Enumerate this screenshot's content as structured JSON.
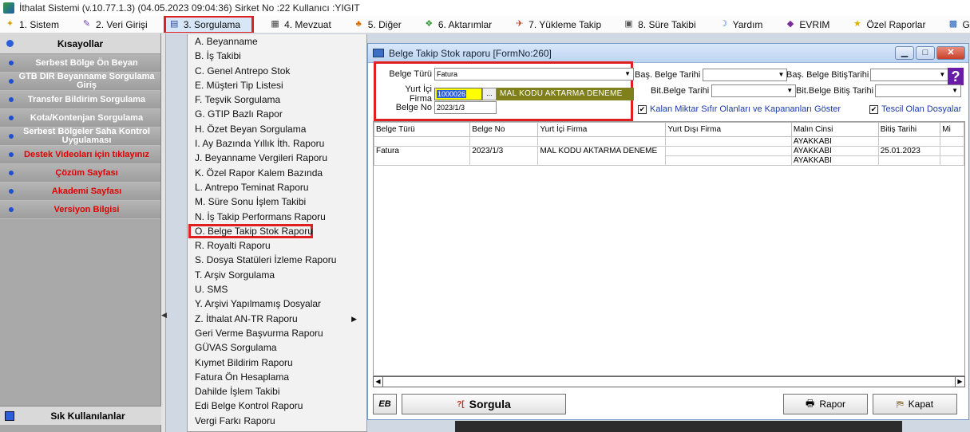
{
  "window": {
    "title": "İthalat Sistemi (v.10.77.1.3) (04.05.2023 09:04:36) Sirket No :22 Kullanıcı :YIGIT"
  },
  "menubar": [
    {
      "label": "1.  Sistem",
      "icon": "✦",
      "color": "#d4a017"
    },
    {
      "label": "2. Veri Girişi",
      "icon": "✎",
      "color": "#6a3fb0"
    },
    {
      "label": "3. Sorgulama",
      "icon": "▤",
      "color": "#2c4f9e"
    },
    {
      "label": "4. Mevzuat",
      "icon": "▦",
      "color": "#444"
    },
    {
      "label": "5. Diğer",
      "icon": "♣",
      "color": "#d86b00"
    },
    {
      "label": "6. Aktarımlar",
      "icon": "❖",
      "color": "#3a9b3a"
    },
    {
      "label": "7. Yükleme Takip",
      "icon": "✈",
      "color": "#c04020"
    },
    {
      "label": "8. Süre Takibi",
      "icon": "▣",
      "color": "#555"
    },
    {
      "label": "Yardım",
      "icon": "☽",
      "color": "#2a6fd8"
    },
    {
      "label": "EVRIM",
      "icon": "◆",
      "color": "#7a2a9e"
    },
    {
      "label": "Özel Raporlar",
      "icon": "★",
      "color": "#e0b000"
    },
    {
      "label": "Grafi",
      "icon": "▩",
      "color": "#1a5fb4"
    }
  ],
  "sidebar": {
    "header": "Kısayollar",
    "items": [
      {
        "label": "Serbest Bölge Ön Beyan",
        "red": false
      },
      {
        "label": "GTB DIR Beyanname Sorgulama Giriş",
        "red": false
      },
      {
        "label": "Transfer Bildirim Sorgulama",
        "red": false
      },
      {
        "label": "Kota/Kontenjan Sorgulama",
        "red": false
      },
      {
        "label": "Serbest Bölgeler Saha Kontrol Uygulaması",
        "red": false
      },
      {
        "label": "Destek Videoları için tıklayınız",
        "red": true
      },
      {
        "label": "Çözüm Sayfası",
        "red": true
      },
      {
        "label": "Akademi Sayfası",
        "red": true
      },
      {
        "label": "Versiyon Bilgisi",
        "red": true
      }
    ],
    "footer": "Sık Kullanılanlar"
  },
  "dropdown": {
    "items": [
      "A.  Beyanname",
      "B.  İş Takibi",
      "C.  Genel Antrepo Stok",
      "E.  Müşteri Tip Listesi",
      "F.  Teşvik Sorgulama",
      "G.  GTIP Bazlı Rapor",
      "H.  Özet Beyan Sorgulama",
      "I.  Ay Bazında Yıllık İth. Raporu",
      "J.  Beyanname Vergileri Raporu",
      "K. Özel Rapor Kalem Bazında",
      "L.  Antrepo Teminat Raporu",
      "M.  Süre Sonu İşlem Takibi",
      "N.  İş Takip Performans Raporu",
      "O.  Belge Takip Stok Raporu",
      "R.  Royalti Raporu",
      "S.  Dosya Statüleri İzleme Raporu",
      "T.  Arşiv Sorgulama",
      "U.  SMS",
      "Y.  Arşivi Yapılmamış Dosyalar",
      "Z.  İthalat AN-TR Raporu",
      "Geri Verme Başvurma Raporu",
      "GÜVAS Sorgulama",
      "Kıymet Bildirim Raporu",
      "Fatura Ön Hesaplama",
      "Dahilde İşlem Takibi",
      "Edi Belge Kontrol Raporu",
      "Vergi Farkı Raporu"
    ]
  },
  "form": {
    "title": "Belge Takip Stok raporu [FormNo:260]",
    "belge_turu_label": "Belge Türü",
    "belge_turu_value": "Fatura",
    "yurt_ici_firma_label": "Yurt İçi Firma",
    "yurt_ici_firma_code": "1000026",
    "yurt_ici_firma_name": "MAL KODU AKTARMA DENEME",
    "dots_label": "...",
    "belge_no_label": "Belge No",
    "belge_no_value": "2023/1/3",
    "bas_belge_tarihi_label": "Baş. Belge Tarihi",
    "bas_belge_bitis_tarihi_label": "Baş. Belge BitişTarihi",
    "bit_belge_tarihi_label": "Bit.Belge Tarihi",
    "bit_belge_bitis_tarihi_label": "Bit.Belge Bitiş Tarihi",
    "chk_kalan_label": "Kalan Miktar Sıfır Olanları ve Kapananları Göster",
    "chk_tescil_label": "Tescil Olan Dosyalar",
    "help_label": "?"
  },
  "grid": {
    "columns": [
      "Belge Türü",
      "Belge No",
      "Yurt İçi Firma",
      "Yurt Dışı Firma",
      "Malın Cinsi",
      "Bitiş Tarihi",
      "Mi"
    ],
    "row": {
      "belge_turu": "Fatura",
      "belge_no": "2023/1/3",
      "yurt_ici_firma": "MAL KODU AKTARMA DENEME",
      "malin_cinsi": [
        "AYAKKABI",
        "AYAKKABI",
        "AYAKKABI"
      ],
      "bitis_tarihi": "25.01.2023"
    }
  },
  "buttons": {
    "eb_label": "EB",
    "sorgula_label": "Sorgula",
    "sorgula_icon": "?[",
    "rapor_label": "Rapor",
    "kapat_label": "Kapat"
  }
}
